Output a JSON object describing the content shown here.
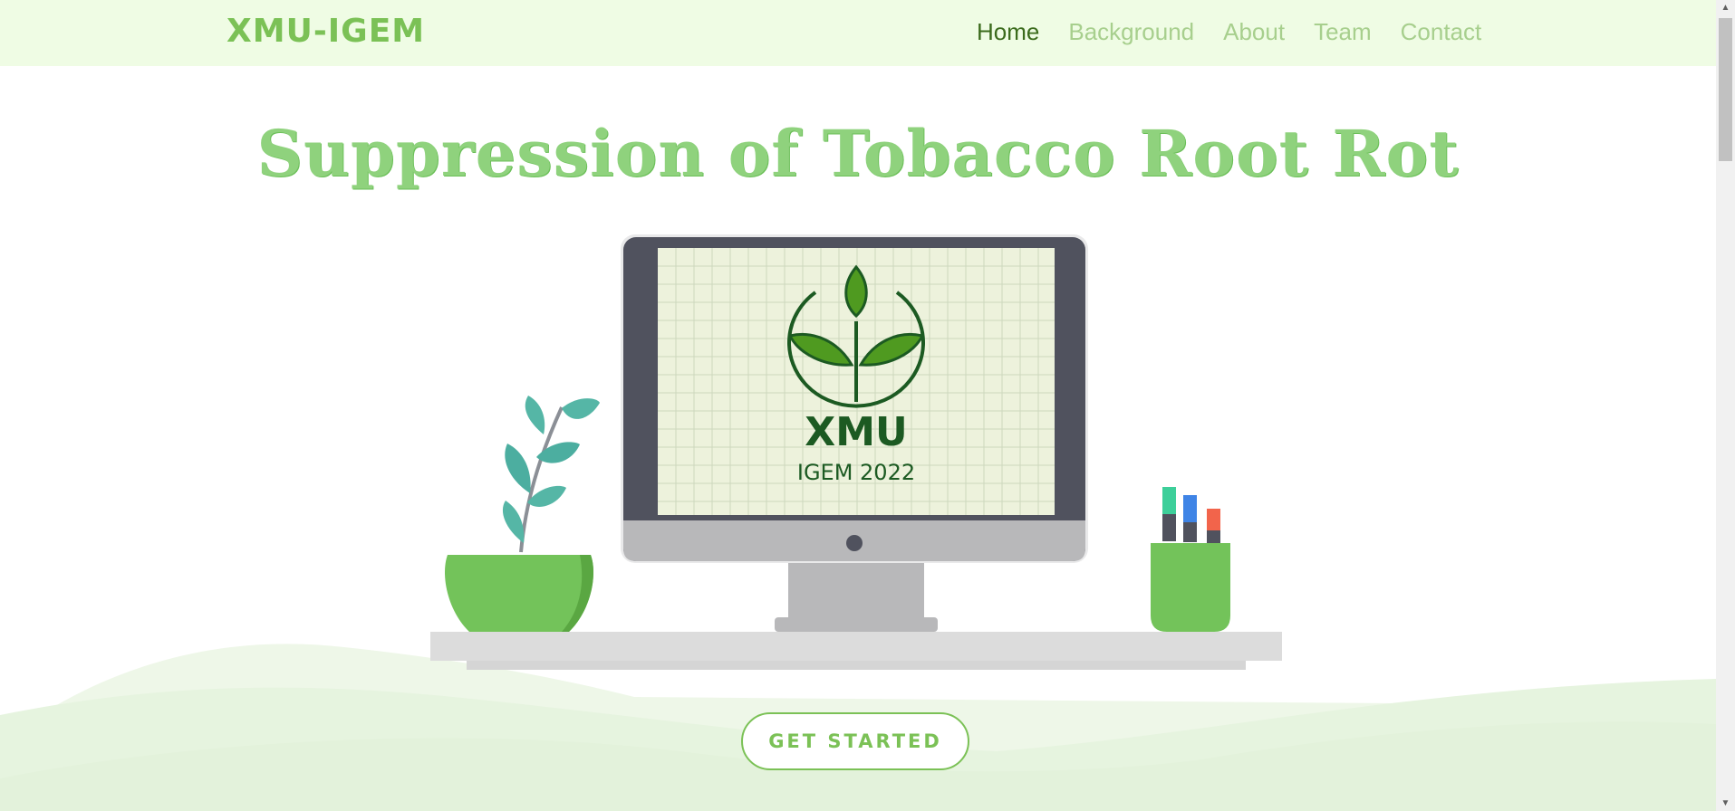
{
  "header": {
    "logo": "XMU-IGEM",
    "nav": [
      {
        "label": "Home",
        "active": true
      },
      {
        "label": "Background",
        "active": false
      },
      {
        "label": "About",
        "active": false
      },
      {
        "label": "Team",
        "active": false
      },
      {
        "label": "Contact",
        "active": false
      }
    ]
  },
  "hero": {
    "title": "Suppression of Tobacco Root Rot",
    "screen_text_main": "XMU",
    "screen_text_sub": "IGEM 2022",
    "cta_label": "GET STARTED"
  },
  "icons": {
    "logo_emblem": "sprout-icon",
    "plant": "potted-plant-icon",
    "pens": "pen-cup-icon",
    "monitor": "monitor-icon"
  },
  "colors": {
    "header_bg": "#effce4",
    "accent": "#7bc156",
    "nav_active": "#3b6b1c",
    "nav_inactive": "#a7cf8d",
    "title": "#8fd27d"
  }
}
